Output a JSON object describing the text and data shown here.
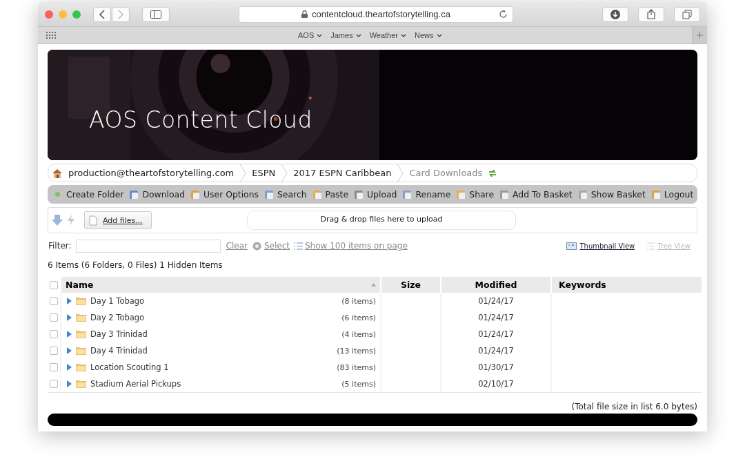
{
  "browser": {
    "url": "contentcloud.theartofstorytelling.ca",
    "bookmarks": [
      "AOS",
      "James",
      "Weather",
      "News"
    ]
  },
  "banner": {
    "title": "AOS Content Cloud"
  },
  "breadcrumbs": [
    {
      "label": "production@theartofstorytelling.com",
      "current": false
    },
    {
      "label": "ESPN",
      "current": false
    },
    {
      "label": "2017 ESPN Caribbean",
      "current": false
    },
    {
      "label": "Card Downloads",
      "current": true
    }
  ],
  "toolbar": [
    "Create Folder",
    "Download",
    "User Options",
    "Search",
    "Paste",
    "Upload",
    "Rename",
    "Share",
    "Add To Basket",
    "Show Basket",
    "Logout"
  ],
  "upload": {
    "add_button": "Add files...",
    "drop_text": "Drag & drop files here to upload"
  },
  "filter": {
    "label": "Filter:",
    "clear": "Clear",
    "select": "Select",
    "show_items": "Show 100 items on page"
  },
  "views": [
    {
      "label": "Thumbnail View",
      "disabled": false
    },
    {
      "label": "Tree View",
      "disabled": true
    }
  ],
  "summary": "6 Items (6 Folders, 0 Files) 1 Hidden Items",
  "table": {
    "header_checked": false,
    "columns": [
      "Name",
      "Size",
      "Modified",
      "Keywords"
    ],
    "rows": [
      {
        "name": "Day 1 Tobago",
        "count": "(8 items)",
        "modified": "01/24/17",
        "checked": false
      },
      {
        "name": "Day 2 Tobago",
        "count": "(6 items)",
        "modified": "01/24/17",
        "checked": false
      },
      {
        "name": "Day 3 Trinidad",
        "count": "(4 items)",
        "modified": "01/24/17",
        "checked": false
      },
      {
        "name": "Day 4 Trinidad",
        "count": "(13 items)",
        "modified": "01/24/17",
        "checked": false
      },
      {
        "name": "Location Scouting 1",
        "count": "(83 items)",
        "modified": "01/30/17",
        "checked": false
      },
      {
        "name": "Stadium Aerial Pickups",
        "count": "(5 items)",
        "modified": "02/10/17",
        "checked": false
      }
    ]
  },
  "total": "(Total file size in list 6.0 bytes)"
}
